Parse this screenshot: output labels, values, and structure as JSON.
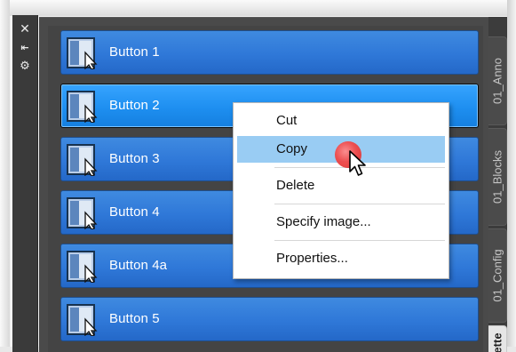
{
  "titlebar_controls": {
    "close_glyph": "✕",
    "autohide_glyph": "⇤",
    "properties_glyph": "⚙"
  },
  "buttons": [
    {
      "label": "Button 1",
      "icon": "tool-button-cursor-icon",
      "state": "normal"
    },
    {
      "label": "Button 2",
      "icon": "tool-button-cursor-icon",
      "state": "hot"
    },
    {
      "label": "Button 3",
      "icon": "tool-button-cursor-icon",
      "state": "normal"
    },
    {
      "label": "Button 4",
      "icon": "tool-button-cursor-icon",
      "state": "normal"
    },
    {
      "label": "Button 4a",
      "icon": "tool-button-cursor-icon",
      "state": "normal"
    },
    {
      "label": "Button 5",
      "icon": "tool-button-cursor-icon",
      "state": "normal"
    }
  ],
  "tabs": [
    {
      "label": "01_Anno",
      "active": false
    },
    {
      "label": "01_Blocks",
      "active": false
    },
    {
      "label": "01_Config",
      "active": false
    },
    {
      "label": "ette",
      "active": true
    }
  ],
  "context_menu": {
    "items": [
      {
        "label": "Cut",
        "selected": false
      },
      {
        "label": "Copy",
        "selected": true
      },
      {
        "label": "Delete",
        "selected": false
      },
      {
        "label": "Specify image...",
        "selected": false
      },
      {
        "label": "Properties...",
        "selected": false
      }
    ]
  },
  "colors": {
    "button_blue": "#2f78d8",
    "button_hot_blue": "#1e8ff0",
    "menu_highlight": "#99ccf3",
    "palette_bg": "#4a4a4a",
    "click_indicator": "#f14848"
  }
}
